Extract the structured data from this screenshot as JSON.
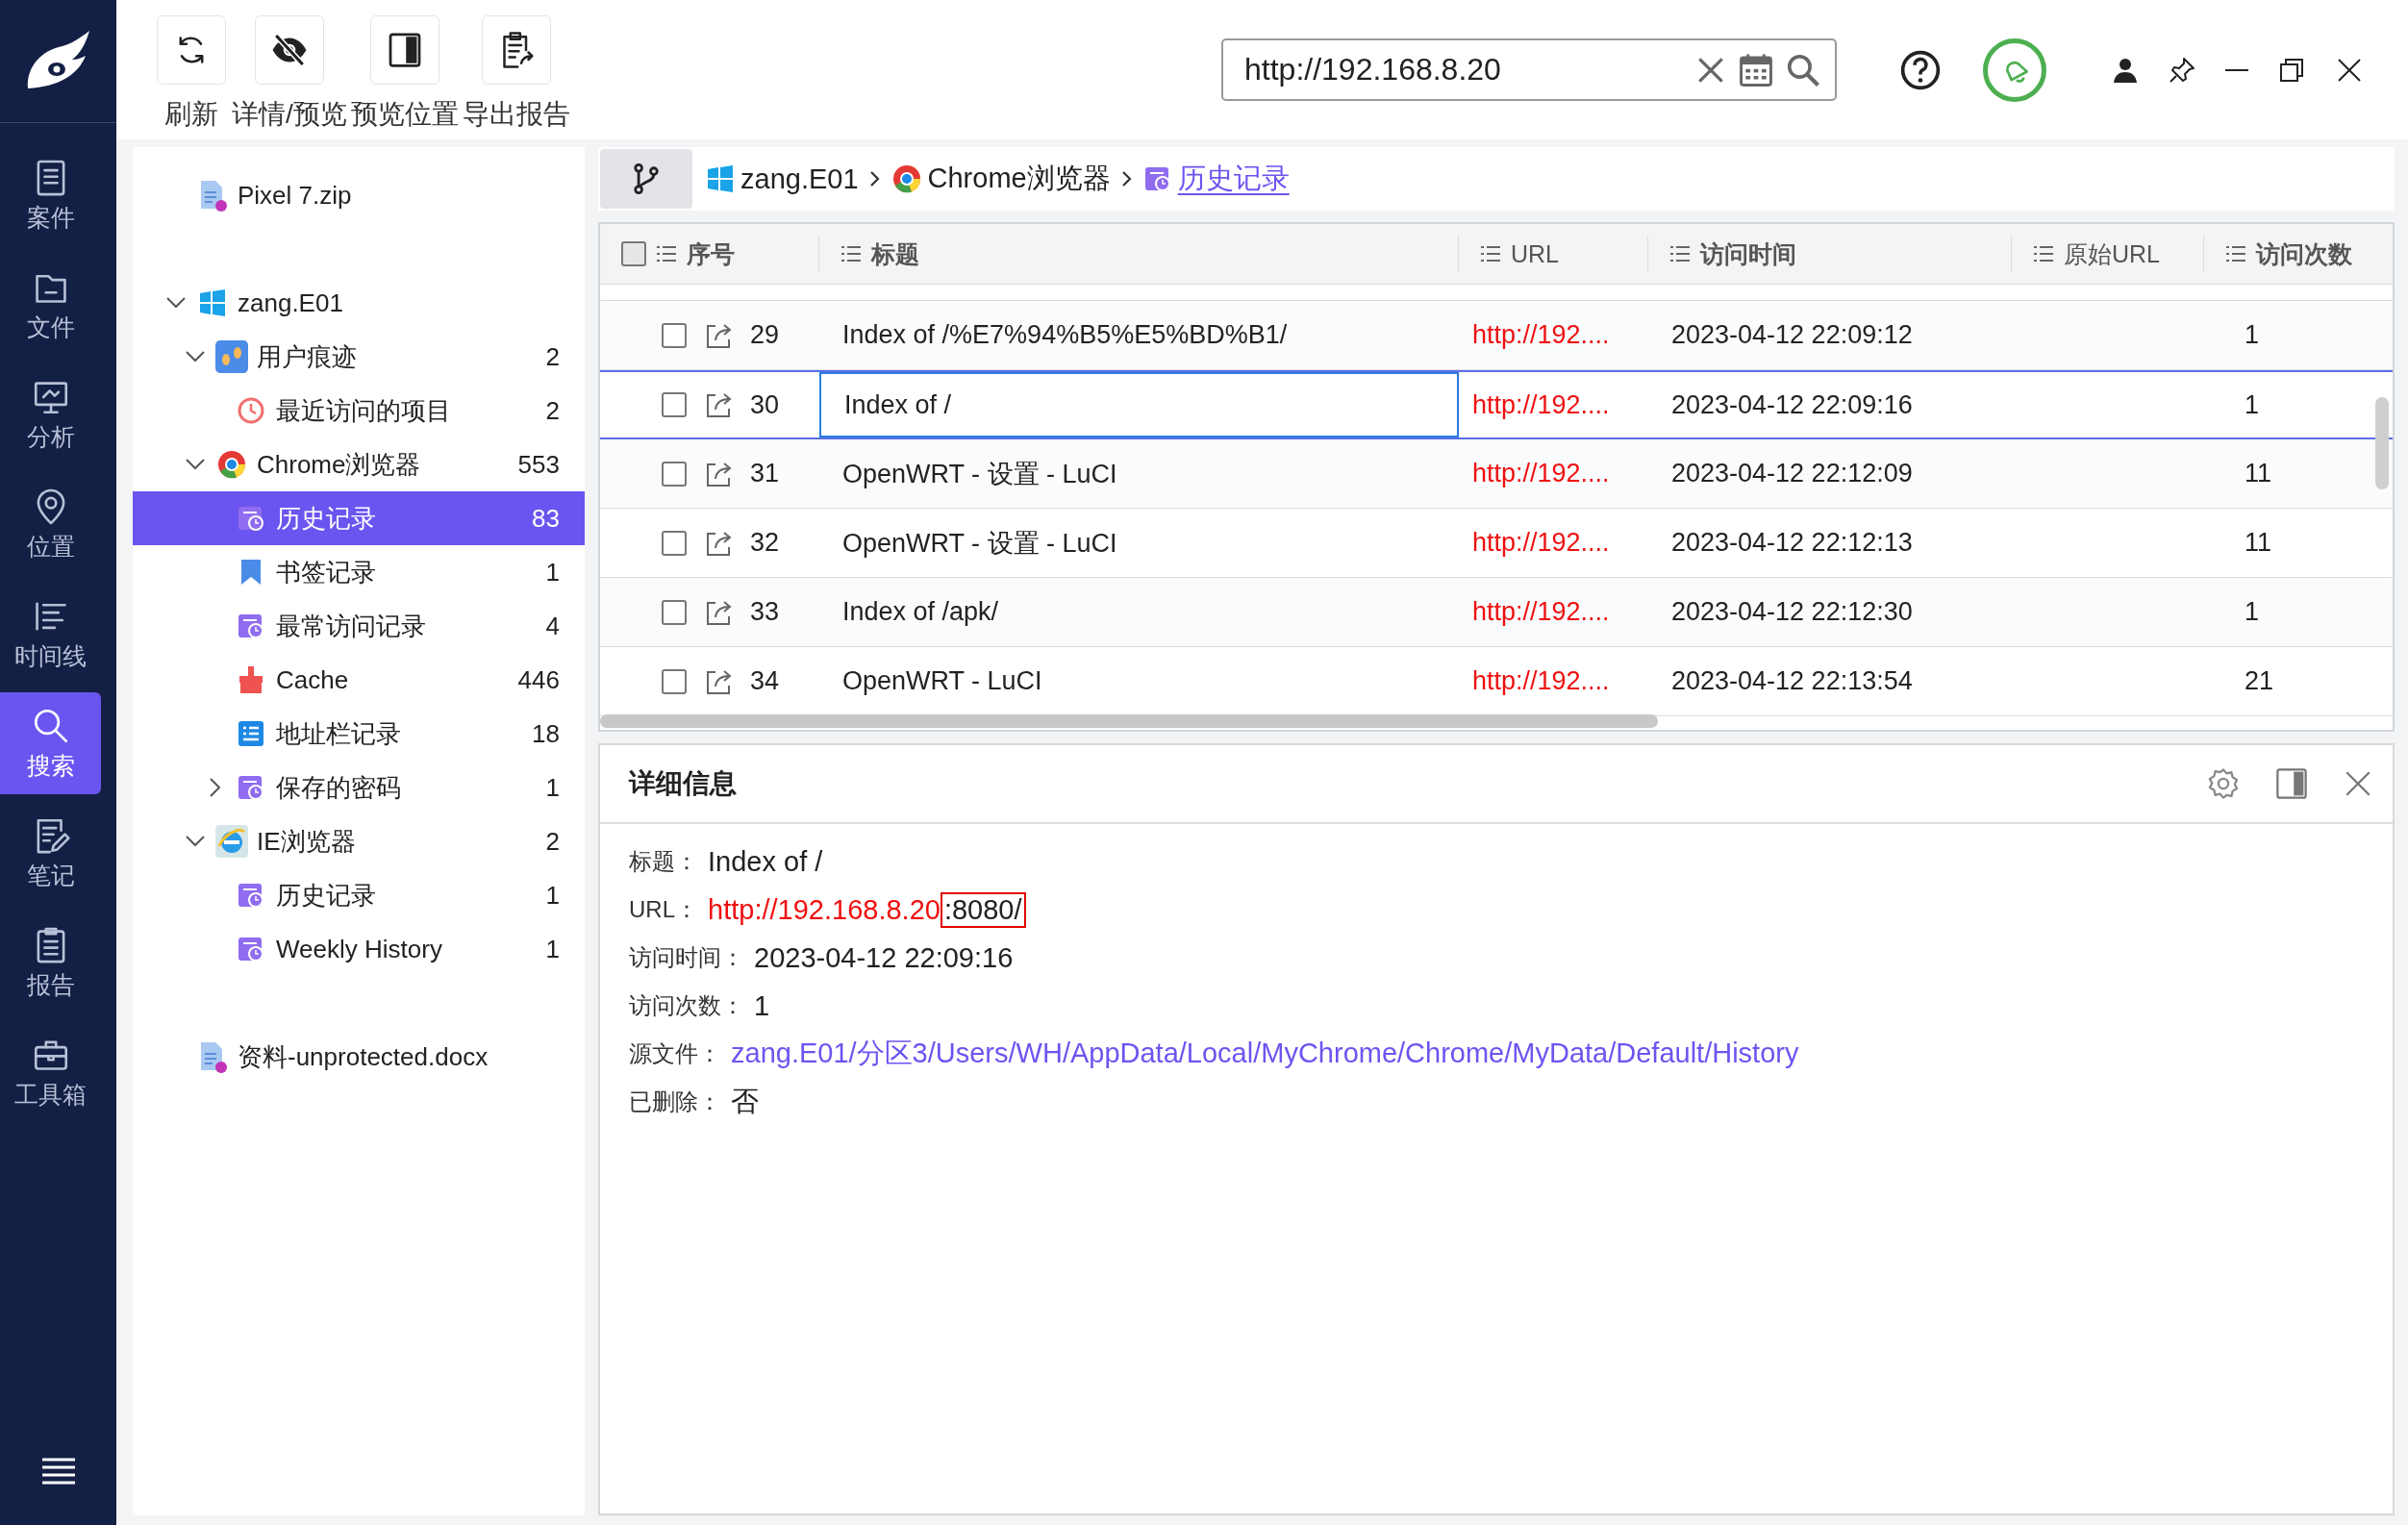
{
  "nav": [
    {
      "label": "案件",
      "selected": false
    },
    {
      "label": "文件",
      "selected": false
    },
    {
      "label": "分析",
      "selected": false
    },
    {
      "label": "位置",
      "selected": false
    },
    {
      "label": "时间线",
      "selected": false
    },
    {
      "label": "搜索",
      "selected": true
    },
    {
      "label": "笔记",
      "selected": false
    },
    {
      "label": "报告",
      "selected": false
    },
    {
      "label": "工具箱",
      "selected": false
    }
  ],
  "toolbar": [
    {
      "label": "刷新"
    },
    {
      "label": "详情/预览"
    },
    {
      "label": "预览位置"
    },
    {
      "label": "导出报告"
    }
  ],
  "search": {
    "value": "http://192.168.8.20"
  },
  "tree": [
    {
      "label": "Pixel 7.zip",
      "kind": "file",
      "selected": false
    },
    {
      "label": "zang.E01",
      "kind": "drive",
      "selected": false,
      "expanded": true,
      "children": [
        {
          "label": "用户痕迹",
          "kind": "category",
          "count": "2",
          "selected": false,
          "expanded": true,
          "children": [
            {
              "label": "最近访问的项目",
              "kind": "recent",
              "count": "2",
              "selected": false
            }
          ]
        },
        {
          "label": "Chrome浏览器",
          "kind": "chrome",
          "count": "553",
          "selected": false,
          "expanded": true,
          "children": [
            {
              "label": "历史记录",
              "kind": "history",
              "count": "83",
              "selected": true
            },
            {
              "label": "书签记录",
              "kind": "bookmark",
              "count": "1",
              "selected": false
            },
            {
              "label": "最常访问记录",
              "kind": "history",
              "count": "4",
              "selected": false
            },
            {
              "label": "Cache",
              "kind": "cache",
              "count": "446",
              "selected": false
            },
            {
              "label": "地址栏记录",
              "kind": "address",
              "count": "18",
              "selected": false
            },
            {
              "label": "保存的密码",
              "kind": "history",
              "count": "1",
              "selected": false,
              "expanded": false
            }
          ]
        },
        {
          "label": "IE浏览器",
          "kind": "ie",
          "count": "2",
          "selected": false,
          "expanded": true,
          "children": [
            {
              "label": "历史记录",
              "kind": "history",
              "count": "1",
              "selected": false
            },
            {
              "label": "Weekly History",
              "kind": "history",
              "count": "1",
              "selected": false
            }
          ]
        }
      ]
    },
    {
      "label": "资料-unprotected.docx",
      "kind": "file",
      "selected": false
    }
  ],
  "breadcrumb": [
    {
      "label": "zang.E01",
      "kind": "drive",
      "selected": false
    },
    {
      "label": "Chrome浏览器",
      "kind": "chrome",
      "selected": false
    },
    {
      "label": "历史记录",
      "kind": "history",
      "selected": true
    }
  ],
  "table": {
    "select_all": {
      "checked": false
    },
    "columns": [
      "序号",
      "标题",
      "URL",
      "访问时间",
      "原始URL",
      "访问次数"
    ],
    "rows": [
      {
        "index": "29",
        "title": "Index of /%E7%94%B5%E5%BD%B1/",
        "url": "http://192....",
        "time": "2023-04-12 22:09:12",
        "visits": "1",
        "checked": false,
        "selected": false
      },
      {
        "index": "30",
        "title": "Index of /",
        "url": "http://192....",
        "time": "2023-04-12 22:09:16",
        "visits": "1",
        "checked": false,
        "selected": true
      },
      {
        "index": "31",
        "title": "OpenWRT - 设置 - LuCI",
        "url": "http://192....",
        "time": "2023-04-12 22:12:09",
        "visits": "11",
        "checked": false,
        "selected": false
      },
      {
        "index": "32",
        "title": "OpenWRT - 设置 - LuCI",
        "url": "http://192....",
        "time": "2023-04-12 22:12:13",
        "visits": "11",
        "checked": false,
        "selected": false
      },
      {
        "index": "33",
        "title": "Index of /apk/",
        "url": "http://192....",
        "time": "2023-04-12 22:12:30",
        "visits": "1",
        "checked": false,
        "selected": false
      },
      {
        "index": "34",
        "title": "OpenWRT - LuCI",
        "url": "http://192....",
        "time": "2023-04-12 22:13:54",
        "visits": "21",
        "checked": false,
        "selected": false
      }
    ]
  },
  "detail": {
    "title": "详细信息",
    "fields": [
      {
        "label": "标题：",
        "kind": "text",
        "value": "Index of /"
      },
      {
        "label": "URL：",
        "kind": "url",
        "value": "http://192.168.8.20",
        "highlight": ":8080/"
      },
      {
        "label": "访问时间：",
        "kind": "text",
        "value": "2023-04-12 22:09:16"
      },
      {
        "label": "访问次数：",
        "kind": "text",
        "value": "1"
      },
      {
        "label": "源文件：",
        "kind": "link",
        "value": "zang.E01/分区3/Users/WH/AppData/Local/MyChrome/Chrome/MyData/Default/History"
      },
      {
        "label": "已删除：",
        "kind": "text",
        "value": "否"
      }
    ]
  }
}
